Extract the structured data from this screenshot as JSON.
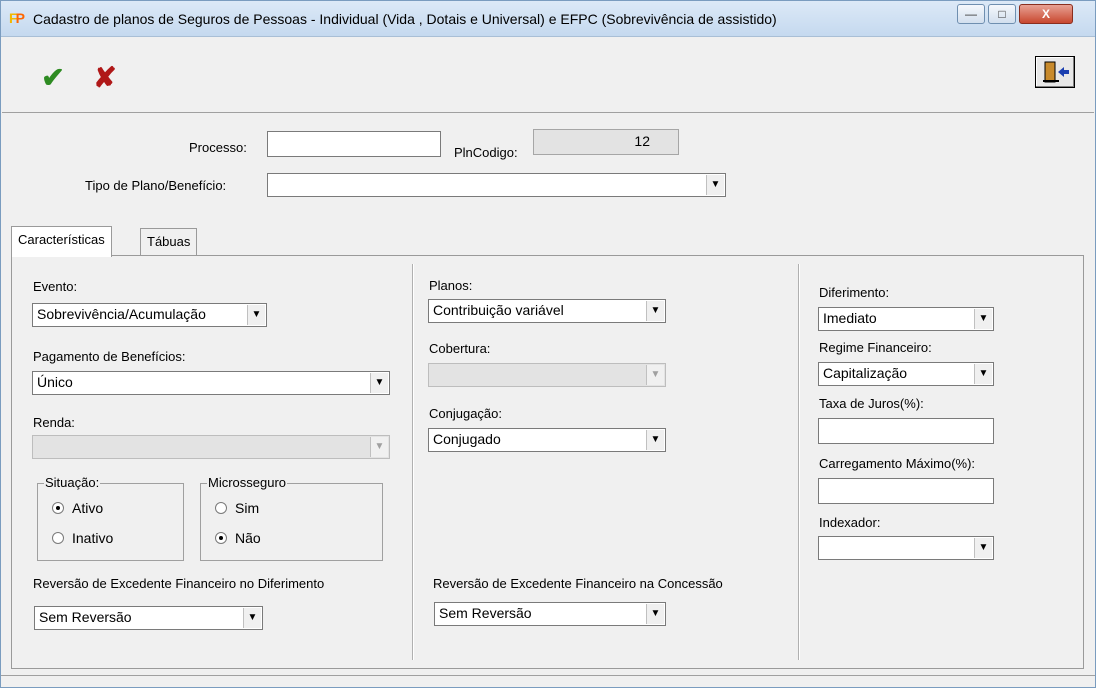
{
  "window": {
    "title": "Cadastro de planos de Seguros de Pessoas - Individual (Vida , Dotais e Universal) e EFPC (Sobrevivência de assistido)",
    "icon": "FP",
    "minimize_label": "—",
    "maximize_label": "□",
    "close_label": "X"
  },
  "toolbar": {
    "confirm_icon": "checkmark-icon",
    "cancel_icon": "x-icon",
    "exit_icon": "exit-door-icon"
  },
  "header": {
    "processo_label": "Processo:",
    "processo_value": "",
    "plncodigo_label": "PlnCodigo:",
    "plncodigo_value": "12",
    "tipo_plano_label": "Tipo de Plano/Benefício:",
    "tipo_plano_value": ""
  },
  "tabs": [
    {
      "label": "Características",
      "active": true
    },
    {
      "label": "Tábuas",
      "active": false
    }
  ],
  "col1": {
    "evento_label": "Evento:",
    "evento_value": "Sobrevivência/Acumulação",
    "pagamento_label": "Pagamento de Benefícios:",
    "pagamento_value": "Único",
    "renda_label": "Renda:",
    "renda_value": "",
    "situacao": {
      "title": "Situação:",
      "options": [
        {
          "label": "Ativo",
          "checked": true
        },
        {
          "label": "Inativo",
          "checked": false
        }
      ]
    },
    "microsseguro": {
      "title": "Microsseguro",
      "options": [
        {
          "label": "Sim",
          "checked": false
        },
        {
          "label": "Não",
          "checked": true
        }
      ]
    },
    "reversao_label": "Reversão de Excedente Financeiro no Diferimento",
    "reversao_value": "Sem Reversão"
  },
  "col2": {
    "planos_label": "Planos:",
    "planos_value": "Contribuição variável",
    "cobertura_label": "Cobertura:",
    "cobertura_value": "",
    "conjugacao_label": "Conjugação:",
    "conjugacao_value": "Conjugado",
    "reversao_label": "Reversão de Excedente Financeiro na Concessão",
    "reversao_value": "Sem Reversão"
  },
  "col3": {
    "diferimento_label": "Diferimento:",
    "diferimento_value": "Imediato",
    "regime_label": "Regime Financeiro:",
    "regime_value": "Capitalização",
    "taxa_label": "Taxa de Juros(%):",
    "taxa_value": "",
    "carregamento_label": "Carregamento Máximo(%):",
    "carregamento_value": "",
    "indexador_label": "Indexador:",
    "indexador_value": ""
  },
  "arrow_glyph": "▼"
}
